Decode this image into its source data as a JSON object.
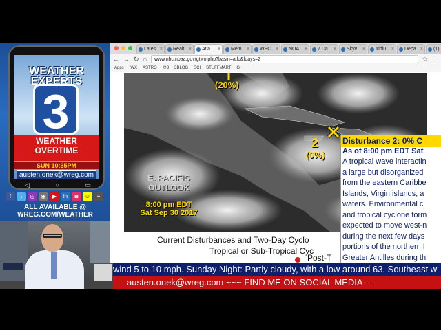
{
  "promo": {
    "brand": "WEATHER EXPERTS",
    "channel_number": "3",
    "overtime_line1": "WEATHER",
    "overtime_line2": "OVERTIME",
    "show_time": "SUN 10:35PM",
    "email": "austen.onek@wreg.com",
    "availability_line1": "ALL AVAILABLE @",
    "availability_line2": "WREG.COM/WEATHER"
  },
  "browser": {
    "tabs": [
      {
        "label": "Lates"
      },
      {
        "label": "Realt"
      },
      {
        "label": "Atla"
      },
      {
        "label": "Mem"
      },
      {
        "label": "WPC"
      },
      {
        "label": "NOA"
      },
      {
        "label": "7 Da"
      },
      {
        "label": "Skyv"
      },
      {
        "label": "Iridiu"
      },
      {
        "label": "Depa"
      },
      {
        "label": "(1)"
      }
    ],
    "url": "www.nhc.noaa.gov/gtwo.php?basin=atlc&fdays=2",
    "bookmarks": [
      "Apps",
      "IWX",
      "ASTRO",
      "@3",
      "3BLOG",
      "SCI",
      "STUFFMART",
      "G"
    ],
    "colors": {
      "close": "#ff5f57",
      "minimize": "#febc2e",
      "zoom": "#28c840"
    }
  },
  "map": {
    "disturbance1_pct": "(20%)",
    "disturbance2_number": "2",
    "disturbance2_pct": "(0%)",
    "pacific_outlook": "E. PACIFIC\nOUTLOOK",
    "time_stamp_line1": "8:00 pm EDT",
    "time_stamp_line2": "Sat Sep 30 2017",
    "caption_line1": "Current Disturbances and Two-Day Cyclo",
    "caption_line2": "Tropical or Sub-Tropical Cyc",
    "legend_text": "Post-T"
  },
  "popup": {
    "title": "Disturbance 2: 0% C",
    "time": "As of 8:00 pm EDT Sat",
    "lines": [
      "A tropical wave interactin",
      "a large but disorganized",
      "from the eastern Caribbe",
      "Islands, Virgin islands, a",
      "waters. Environmental c",
      "and tropical cyclone form",
      "expected to move west-n",
      "during the next few days",
      "portions of the northern I",
      "Greater Antilles during th"
    ]
  },
  "tickers": {
    "weather": "wind 5 to 10 mph.   Sunday Night:  Partly cloudy, with a low around 63. Southeast w",
    "social": "austen.onek@wreg.com ~~~  FIND ME ON SOCIAL MEDIA ---"
  }
}
